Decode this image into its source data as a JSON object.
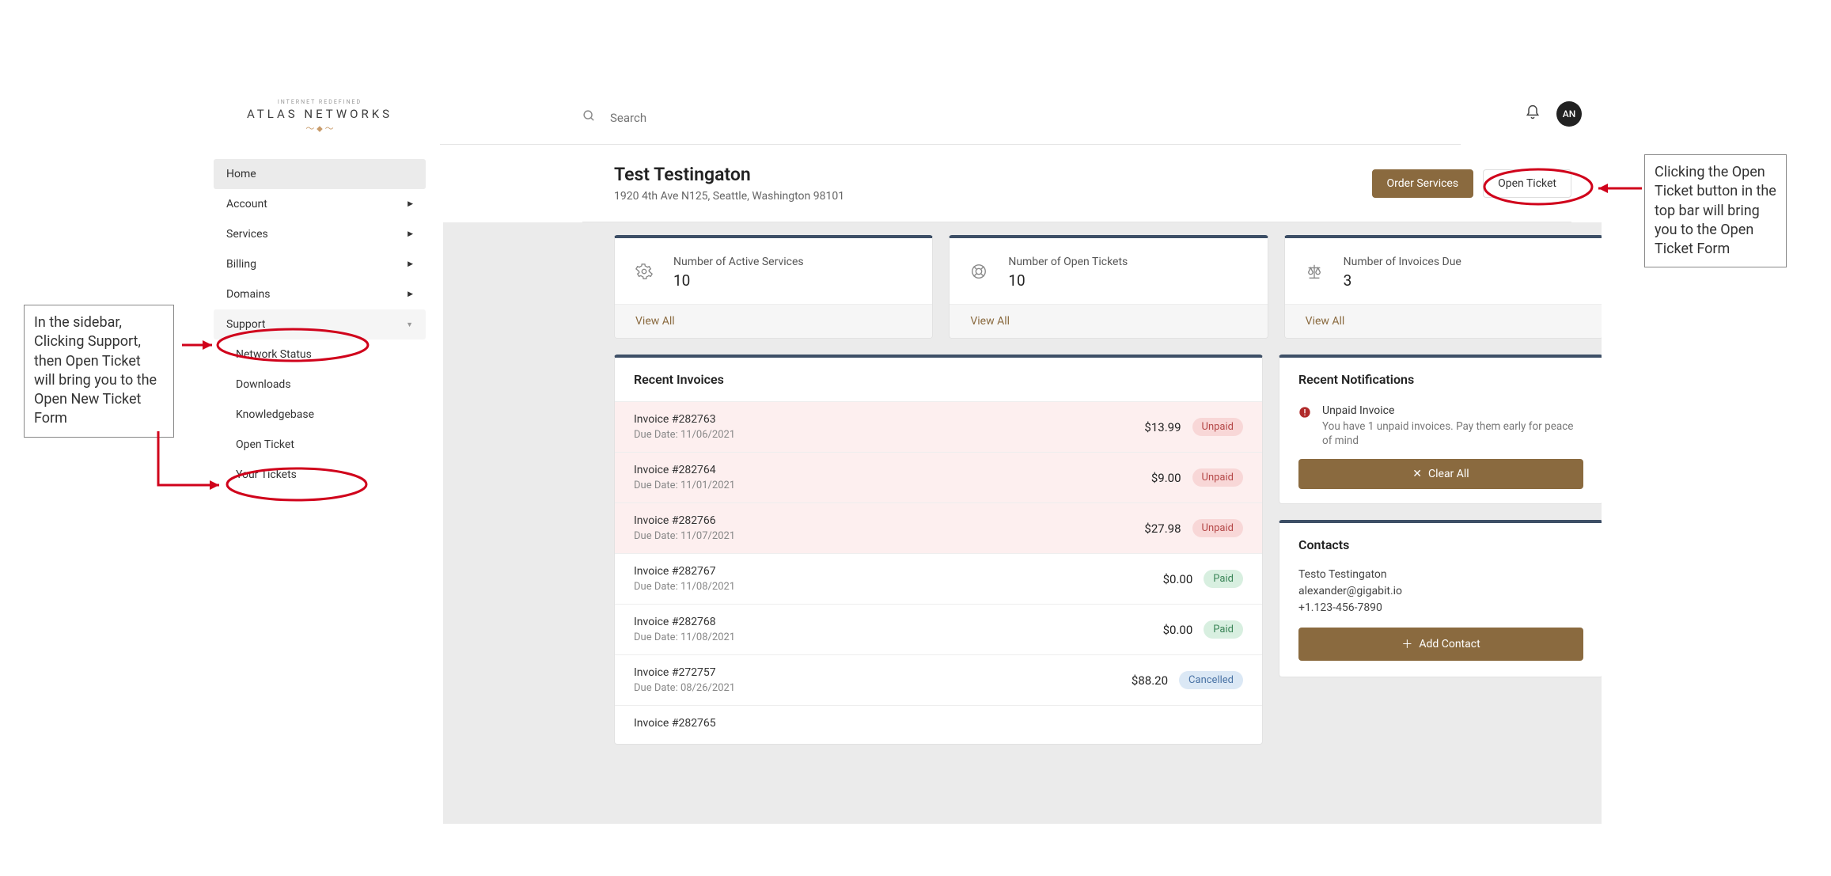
{
  "logo": {
    "small": "INTERNET REDEFINED",
    "main": "ATLAS NETWORKS"
  },
  "search_placeholder": "Search",
  "avatar_initials": "AN",
  "sidebar": {
    "home": "Home",
    "account": "Account",
    "services": "Services",
    "billing": "Billing",
    "domains": "Domains",
    "support": "Support",
    "sub": {
      "network_status": "Network Status",
      "downloads": "Downloads",
      "knowledgebase": "Knowledgebase",
      "open_ticket": "Open Ticket",
      "your_tickets": "Your Tickets"
    }
  },
  "header": {
    "title": "Test Testingaton",
    "subtitle": "1920 4th Ave N125, Seattle, Washington 98101",
    "order_services": "Order Services",
    "open_ticket": "Open Ticket"
  },
  "stats": {
    "services": {
      "label": "Number of Active Services",
      "value": "10",
      "link": "View All"
    },
    "tickets": {
      "label": "Number of Open Tickets",
      "value": "10",
      "link": "View All"
    },
    "invoices": {
      "label": "Number of Invoices Due",
      "value": "3",
      "link": "View All"
    }
  },
  "invoices": {
    "heading": "Recent Invoices",
    "due_prefix": "Due Date: ",
    "rows": [
      {
        "name": "Invoice #282763",
        "due": "11/06/2021",
        "amount": "$13.99",
        "status": "Unpaid",
        "cls": "unpaid"
      },
      {
        "name": "Invoice #282764",
        "due": "11/01/2021",
        "amount": "$9.00",
        "status": "Unpaid",
        "cls": "unpaid"
      },
      {
        "name": "Invoice #282766",
        "due": "11/07/2021",
        "amount": "$27.98",
        "status": "Unpaid",
        "cls": "unpaid"
      },
      {
        "name": "Invoice #282767",
        "due": "11/08/2021",
        "amount": "$0.00",
        "status": "Paid",
        "cls": "paid"
      },
      {
        "name": "Invoice #282768",
        "due": "11/08/2021",
        "amount": "$0.00",
        "status": "Paid",
        "cls": "paid"
      },
      {
        "name": "Invoice #272757",
        "due": "08/26/2021",
        "amount": "$88.20",
        "status": "Cancelled",
        "cls": "cancel"
      },
      {
        "name": "Invoice #282765",
        "due": "",
        "amount": "",
        "status": "",
        "cls": ""
      }
    ]
  },
  "notifications": {
    "heading": "Recent Notifications",
    "item_title": "Unpaid Invoice",
    "item_desc": "You have 1 unpaid invoices. Pay them early for peace of mind",
    "clear": "Clear All"
  },
  "contacts": {
    "heading": "Contacts",
    "name": "Testo Testingaton",
    "email": "alexander@gigabit.io",
    "phone": "+1.123-456-7890",
    "add": "Add Contact"
  },
  "annotations": {
    "left": "In the sidebar, Clicking Support, then Open Ticket will bring you to the Open New Ticket Form",
    "right": "Clicking the Open Ticket button in the top bar will bring you to the Open Ticket Form"
  }
}
